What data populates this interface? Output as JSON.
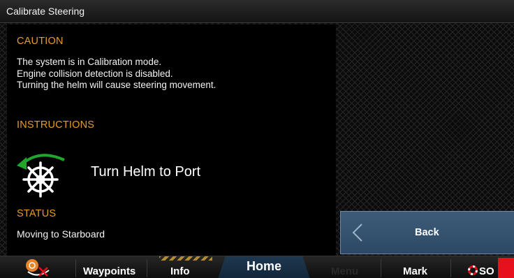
{
  "window": {
    "title": "Calibrate Steering"
  },
  "caution": {
    "heading": "CAUTION",
    "lines": [
      "The system is in Calibration mode.",
      "Engine collision detection is disabled.",
      "Turning the helm will cause steering movement."
    ]
  },
  "instructions": {
    "heading": "INSTRUCTIONS",
    "text": "Turn Helm to Port",
    "icon": "helm-wheel-icon",
    "arrow_color": "#1fa62c"
  },
  "status": {
    "heading": "STATUS",
    "text": "Moving to Starboard"
  },
  "back_button": {
    "label": "Back"
  },
  "bottom_bar": {
    "tabs": [
      {
        "label": "Waypoints"
      },
      {
        "label": "Info"
      },
      {
        "label": "Home"
      },
      {
        "label": "Menu"
      },
      {
        "label": "Mark"
      },
      {
        "label": "SO"
      }
    ]
  },
  "colors": {
    "section_heading": "#e69a2a",
    "back_button": "#34526f",
    "sos_red": "#e8101d"
  }
}
